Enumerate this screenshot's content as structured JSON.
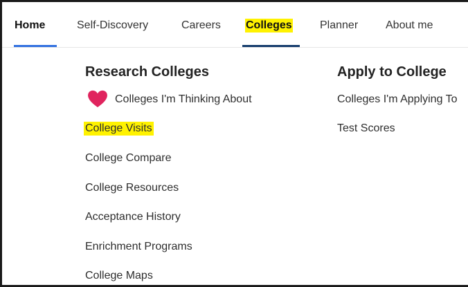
{
  "nav": {
    "items": [
      {
        "label": "Home"
      },
      {
        "label": "Self-Discovery"
      },
      {
        "label": "Careers"
      },
      {
        "label": "Colleges"
      },
      {
        "label": "Planner"
      },
      {
        "label": "About me"
      }
    ]
  },
  "research": {
    "title": "Research Colleges",
    "links": [
      {
        "label": "Colleges I'm Thinking About"
      },
      {
        "label": "College Visits"
      },
      {
        "label": "College Compare"
      },
      {
        "label": "College Resources"
      },
      {
        "label": "Acceptance History"
      },
      {
        "label": "Enrichment Programs"
      },
      {
        "label": "College Maps"
      }
    ]
  },
  "apply": {
    "title": "Apply to College",
    "links": [
      {
        "label": "Colleges I'm Applying To"
      },
      {
        "label": "Test Scores"
      }
    ]
  },
  "colors": {
    "home_underline": "#2f6fe0",
    "colleges_underline": "#123a6b",
    "highlight": "#fff200",
    "heart": "#e0245e"
  },
  "icons": {
    "favorite": "heart-icon"
  }
}
